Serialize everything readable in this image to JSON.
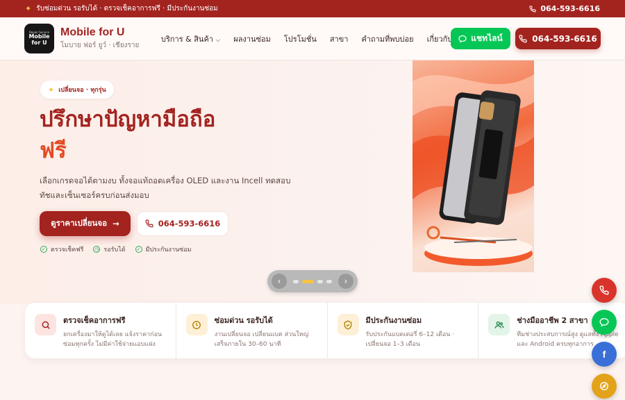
{
  "topbar": {
    "notice": "รับซ่อมด่วน รอรับได้ · ตรวจเช็คอาการฟรี · มีประกันงานซ่อม",
    "phone": "064-593-6616"
  },
  "header": {
    "logo_small": "Repair Service",
    "logo_text": "Mobile for U",
    "brand_name": "Mobile for U",
    "brand_tagline": "โมบาย ฟอร์ ยูว์ · เชียงราย",
    "nav": [
      {
        "label": "บริการ & สินค้า"
      },
      {
        "label": "ผลงานซ่อม"
      },
      {
        "label": "โปรโมชั่น"
      },
      {
        "label": "สาขา"
      },
      {
        "label": "คำถามที่พบบ่อย"
      },
      {
        "label": "เกี่ยวกับเรา"
      }
    ],
    "line_button": "แชทไลน์",
    "call_button": "064-593-6616"
  },
  "hero": {
    "chip": "เปลี่ยนจอ · ทุกรุ่น",
    "title": "ปรึกษาปัญหามือถือ",
    "title_accent": "ฟรี",
    "description": "เลือกเกรดจอได้ตามงบ ทั้งจอแท้ถอดเครื่อง OLED และงาน Incell ทดสอบทัชและเซ็นเซอร์ครบก่อนส่งมอบ",
    "cta_primary": "ดูราคาเปลี่ยนจอ",
    "cta_secondary": "064-593-6616",
    "checks": [
      "ตรวจเช็คฟรี",
      "รอรับได้",
      "มีประกันงานซ่อม"
    ],
    "slider_active_index": 1,
    "slider_count": 4
  },
  "features": [
    {
      "title": "ตรวจเช็คอาการฟรี",
      "desc": "ยกเครื่องมาให้ดูได้เลย แจ้งราคาก่อนซ่อมทุกครั้ง ไม่มีค่าใช้จ่ายแอบแฝง",
      "icon": "search-icon",
      "color": "#fde4e1"
    },
    {
      "title": "ซ่อมด่วน รอรับได้",
      "desc": "งานเปลี่ยนจอ เปลี่ยนแบต ส่วนใหญ่เสร็จภายใน 30–60 นาที",
      "icon": "clock-icon",
      "color": "#fdf0d6"
    },
    {
      "title": "มีประกันงานซ่อม",
      "desc": "รับประกันแบตเตอรี่ 6–12 เดือน · เปลี่ยนจอ 1–3 เดือน",
      "icon": "shield-icon",
      "color": "#fdf0d6"
    },
    {
      "title": "ช่างมืออาชีพ 2 สาขา",
      "desc": "ทีมช่างประสบการณ์สูง ดูแลทั้ง Apple และ Android ครบทุกอาการ",
      "icon": "users-icon",
      "color": "#e3f4e8"
    }
  ],
  "floating": [
    {
      "icon": "phone-icon",
      "color": "#d9342b"
    },
    {
      "icon": "line-icon",
      "color": "#06c755"
    },
    {
      "icon": "facebook-icon",
      "color": "#3b6fd8"
    },
    {
      "icon": "map-icon",
      "color": "#e2a21a"
    }
  ],
  "colors": {
    "brand": "#a3231f",
    "accent": "#e24a22",
    "line": "#06c755"
  }
}
